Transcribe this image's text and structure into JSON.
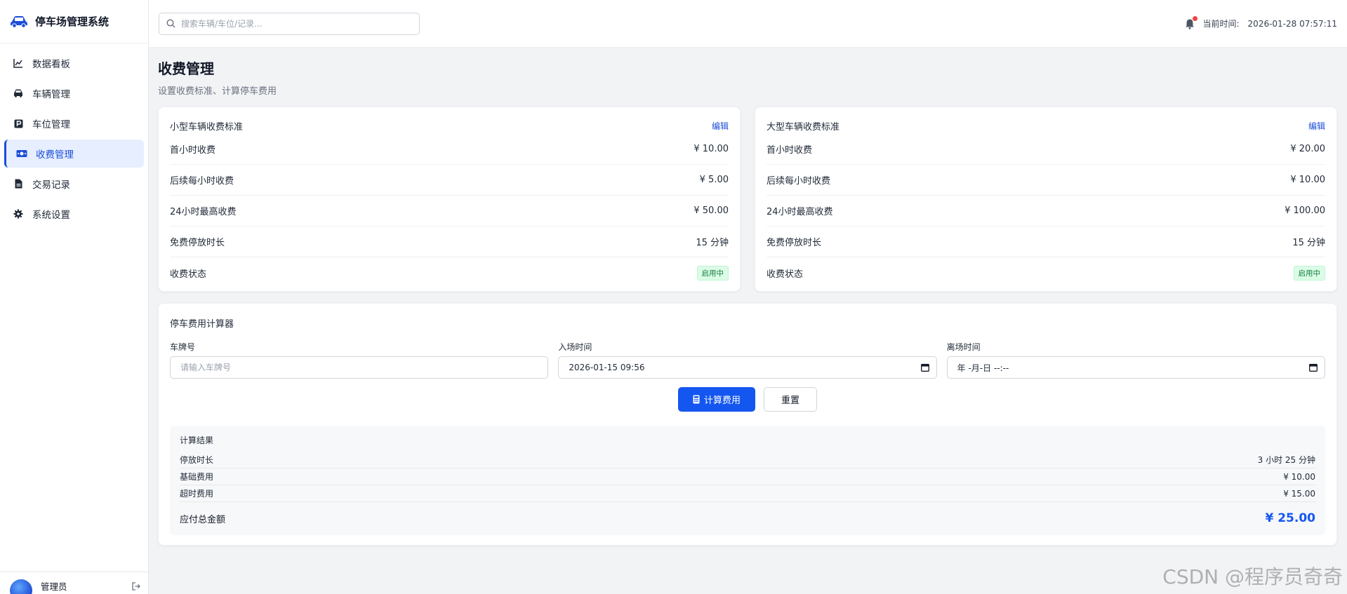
{
  "brand": {
    "title": "停车场管理系统",
    "accent": "#1d4ed8"
  },
  "sidebar": {
    "items": [
      {
        "label": "数据看板",
        "icon": "chart-line-icon",
        "active": false
      },
      {
        "label": "车辆管理",
        "icon": "car-icon",
        "active": false
      },
      {
        "label": "车位管理",
        "icon": "parking-icon",
        "active": false
      },
      {
        "label": "收费管理",
        "icon": "money-icon",
        "active": true
      },
      {
        "label": "交易记录",
        "icon": "file-icon",
        "active": false
      },
      {
        "label": "系统设置",
        "icon": "gear-icon",
        "active": false
      }
    ],
    "user": {
      "name": "管理员"
    }
  },
  "topbar": {
    "search_placeholder": "搜索车辆/车位/记录...",
    "time_label": "当前时间:",
    "time_value": "2026-01-28 07:57:11"
  },
  "page": {
    "title": "收费管理",
    "subtitle": "设置收费标准、计算停车费用"
  },
  "small_card": {
    "title": "小型车辆收费标准",
    "edit_label": "编辑",
    "rows": [
      {
        "label": "首小时收费",
        "value": "¥ 10.00"
      },
      {
        "label": "后续每小时收费",
        "value": "¥ 5.00"
      },
      {
        "label": "24小时最高收费",
        "value": "¥ 50.00"
      },
      {
        "label": "免费停放时长",
        "value": "15 分钟"
      }
    ],
    "status_label": "收费状态",
    "status_badge": "启用中"
  },
  "large_card": {
    "title": "大型车辆收费标准",
    "edit_label": "编辑",
    "rows": [
      {
        "label": "首小时收费",
        "value": "¥ 20.00"
      },
      {
        "label": "后续每小时收费",
        "value": "¥ 10.00"
      },
      {
        "label": "24小时最高收费",
        "value": "¥ 100.00"
      },
      {
        "label": "免费停放时长",
        "value": "15 分钟"
      }
    ],
    "status_label": "收费状态",
    "status_badge": "启用中"
  },
  "calculator": {
    "title": "停车费用计算器",
    "plate_label": "车牌号",
    "plate_placeholder": "请输入车牌号",
    "entry_label": "入场时间",
    "entry_value": "2026-01-15 09:56",
    "exit_label": "离场时间",
    "exit_value": "年 -月-日 --:--",
    "calc_button": "计算费用",
    "reset_button": "重置",
    "result": {
      "title": "计算结果",
      "duration_label": "停放时长",
      "duration_value": "3 小时 25 分钟",
      "base_label": "基础费用",
      "base_value": "¥ 10.00",
      "overtime_label": "超时费用",
      "overtime_value": "¥ 15.00",
      "total_label": "应付总金额",
      "total_value": "¥ 25.00"
    }
  },
  "watermark": "CSDN @程序员奇奇"
}
